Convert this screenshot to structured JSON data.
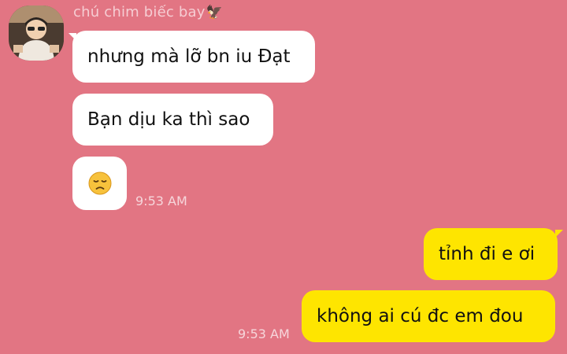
{
  "sender": {
    "name": "chú chim biếc bay",
    "name_icon": "eagle-icon"
  },
  "incoming": [
    {
      "text": "nhưng mà lỡ bn iu Đạt"
    },
    {
      "text": "Bạn dịu ka thì sao"
    },
    {
      "emoji": "sad-face-icon",
      "time": "9:53 AM"
    }
  ],
  "outgoing": [
    {
      "text": "tỉnh đi e ơi"
    },
    {
      "text": "không ai cú đc em đou",
      "time": "9:53 AM"
    }
  ],
  "colors": {
    "background": "#e27583",
    "incoming_bubble": "#ffffff",
    "outgoing_bubble": "#fee500",
    "timestamp": "#f6d6db",
    "sender_name": "#f6cdd3"
  }
}
